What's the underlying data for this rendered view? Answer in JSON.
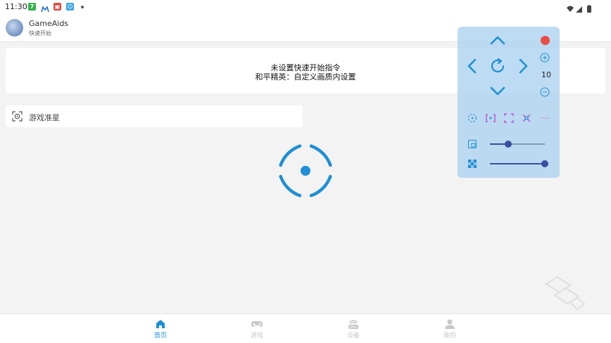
{
  "status_bar": {
    "time": "11:30",
    "icons": [
      "green-7-app-icon",
      "mail-icon",
      "red-app-icon",
      "blue-app-icon",
      "notification-dot-icon",
      "wifi-icon",
      "signal-icon",
      "battery-icon"
    ]
  },
  "header": {
    "app_name": "GameAids",
    "subtitle": "快速开始"
  },
  "message_card": {
    "line1": "未设置快速开始指令",
    "line2": "和平精英：自定义画质内设置"
  },
  "crosshair_row": {
    "label": "游戏准星"
  },
  "panel": {
    "zoom_value": "10",
    "slider1_level": 0.33,
    "slider2_level": 1.0,
    "colors": {
      "record": "#ec4a48",
      "accent": "#1e8fd6",
      "mode": "#c03ad6"
    }
  },
  "bottom_nav": {
    "items": [
      {
        "label": "首页",
        "icon": "home-icon",
        "active": true
      },
      {
        "label": "游戏",
        "icon": "gamepad-icon",
        "active": false
      },
      {
        "label": "设备",
        "icon": "device-icon",
        "active": false
      },
      {
        "label": "我的",
        "icon": "user-icon",
        "active": false
      }
    ]
  }
}
